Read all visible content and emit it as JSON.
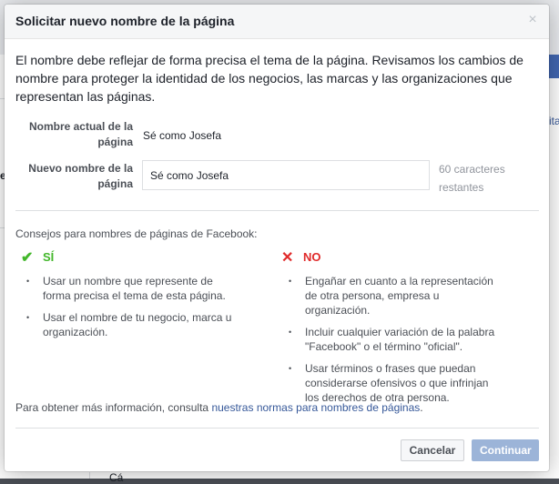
{
  "dialog": {
    "title": "Solicitar nuevo nombre de la página",
    "close_label": "×",
    "intro": "El nombre debe reflejar de forma precisa el tema de la página. Revisamos los cambios de nombre para proteger la identidad de los negocios, las marcas y las organizaciones que representan las páginas."
  },
  "form": {
    "current_label_line1": "Nombre actual de la",
    "current_label_line2": "página",
    "current_value": "Sé como Josefa",
    "new_label_line1": "Nuevo nombre de la",
    "new_label_line2": "página",
    "new_value": "Sé como Josefa",
    "remaining_line1": "60 caracteres",
    "remaining_line2": "restantes"
  },
  "tips": {
    "heading": "Consejos para nombres de páginas de Facebook:",
    "yes": {
      "icon_glyph": "✔",
      "label": "SÍ",
      "items": [
        "Usar un nombre que represente de forma precisa el tema de esta página.",
        "Usar el nombre de tu negocio, marca u organización."
      ]
    },
    "no": {
      "icon_glyph": "✕",
      "label": "NO",
      "items": [
        "Engañar en cuanto a la representación de otra persona, empresa u organización.",
        "Incluir cualquier variación de la palabra \"Facebook\" o el término \"oficial\".",
        "Usar términos o frases que puedan considerarse ofensivos o que infrinjan los derechos de otra persona."
      ]
    }
  },
  "footer": {
    "more_info_prefix": "Para obtener más información, consulta ",
    "more_info_link": "nuestras normas para nombres de páginas",
    "more_info_suffix": ".",
    "cancel_label": "Cancelar",
    "continue_label": "Continuar"
  },
  "backdrop": {
    "peek_right": "ita",
    "peek_left": "e",
    "peek_bottom": "Cá"
  },
  "colors": {
    "accent": "#4267b2",
    "link": "#365899",
    "yes": "#42b72a",
    "no": "#e02a2a",
    "continue_disabled": "#9cb4d8"
  }
}
